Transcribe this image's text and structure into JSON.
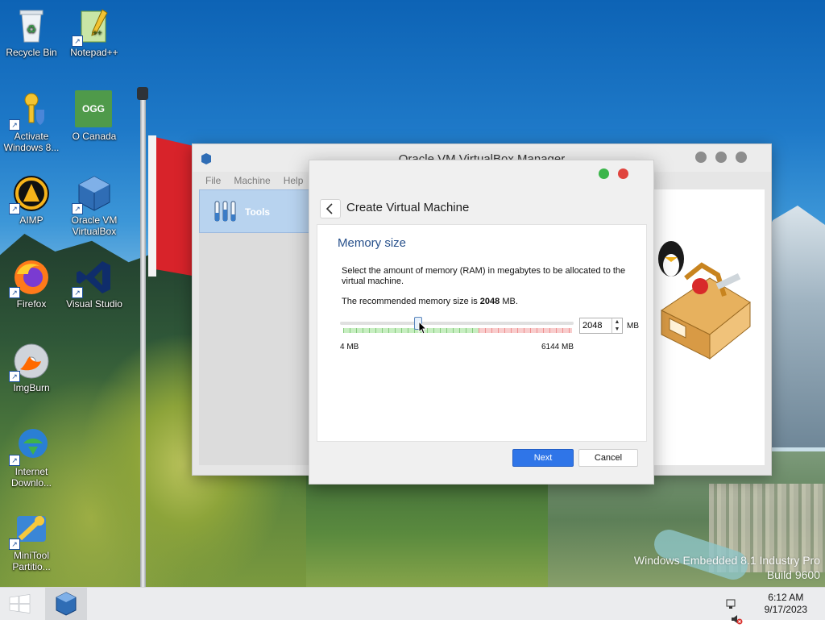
{
  "desktop": {
    "icons": [
      {
        "label": "Recycle Bin",
        "icon": "recycle-bin-icon"
      },
      {
        "label": "Notepad++",
        "icon": "notepad-plus-plus-icon"
      },
      {
        "label": "Activate Windows 8...",
        "icon": "key-shield-icon"
      },
      {
        "label": "O Canada",
        "icon": "ogg-file-icon",
        "badge": "OGG"
      },
      {
        "label": "AIMP",
        "icon": "aimp-icon"
      },
      {
        "label": "Oracle VM VirtualBox",
        "icon": "virtualbox-icon"
      },
      {
        "label": "Firefox",
        "icon": "firefox-icon"
      },
      {
        "label": "Visual Studio",
        "icon": "visual-studio-icon"
      },
      {
        "label": "ImgBurn",
        "icon": "imgburn-icon"
      },
      {
        "label": "Internet Downlo...",
        "icon": "internet-download-manager-icon"
      },
      {
        "label": "MiniTool Partitio...",
        "icon": "minitool-partition-icon"
      }
    ],
    "watermark": {
      "line1": "Windows Embedded 8.1 Industry Pro",
      "line2": "Build 9600"
    }
  },
  "vbox_manager": {
    "title": "Oracle VM VirtualBox Manager",
    "menu": [
      "File",
      "Machine",
      "Help"
    ],
    "sidebar": {
      "tools_label": "Tools"
    }
  },
  "dialog": {
    "title": "Create Virtual Machine",
    "section_title": "Memory size",
    "description": "Select the amount of memory (RAM) in megabytes to be allocated to the virtual machine.",
    "recommended_prefix": "The recommended memory size is ",
    "recommended_value": "2048",
    "recommended_suffix": " MB.",
    "memory": {
      "value": "2048",
      "unit": "MB",
      "min_label": "4 MB",
      "max_label": "6144 MB",
      "slider_fraction": 0.333
    },
    "buttons": {
      "next": "Next",
      "cancel": "Cancel"
    }
  },
  "taskbar": {
    "time": "6:12 AM",
    "date": "9/17/2023"
  },
  "colors": {
    "accent": "#2f75e8",
    "section_title": "#27508b"
  }
}
